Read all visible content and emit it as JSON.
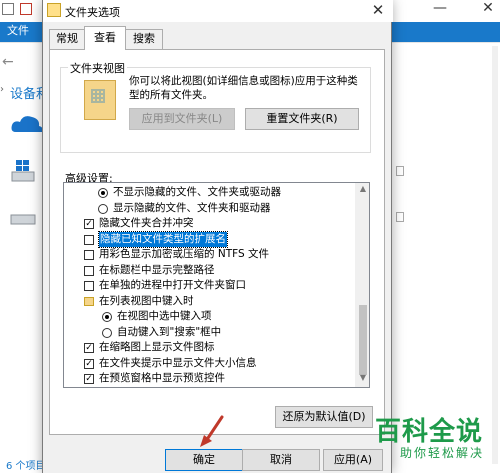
{
  "explorer": {
    "menu": "文件",
    "nav_item": "设备和",
    "status": "6 个项目",
    "minimize_icon": "minimize-icon",
    "close_icon": "close-icon"
  },
  "dialog": {
    "title": "文件夹选项",
    "tabs": [
      {
        "label": "常规"
      },
      {
        "label": "查看"
      },
      {
        "label": "搜索"
      }
    ],
    "folder_views": {
      "group_label": "文件夹视图",
      "description": "你可以将此视图(如详细信息或图标)应用于这种类型的所有文件夹。",
      "apply_button": "应用到文件夹(L)",
      "reset_button": "重置文件夹(R)"
    },
    "advanced_label": "高级设置:",
    "items": [
      {
        "kind": "radio",
        "checked": true,
        "text": "不显示隐藏的文件、文件夹或驱动器"
      },
      {
        "kind": "radio",
        "checked": false,
        "text": "显示隐藏的文件、文件夹和驱动器"
      },
      {
        "kind": "checkbox",
        "checked": true,
        "text": "隐藏文件夹合并冲突"
      },
      {
        "kind": "checkbox",
        "checked": false,
        "text": "隐藏已知文件类型的扩展名",
        "selected": true
      },
      {
        "kind": "checkbox",
        "checked": false,
        "text": "用彩色显示加密或压缩的 NTFS 文件"
      },
      {
        "kind": "checkbox",
        "checked": false,
        "text": "在标题栏中显示完整路径"
      },
      {
        "kind": "checkbox",
        "checked": false,
        "text": "在单独的进程中打开文件夹窗口"
      },
      {
        "kind": "folder",
        "text": "在列表视图中键入时"
      },
      {
        "kind": "radio",
        "checked": true,
        "text": "在视图中选中键入项"
      },
      {
        "kind": "radio",
        "checked": false,
        "text": "自动键入到\"搜索\"框中"
      },
      {
        "kind": "checkbox",
        "checked": true,
        "text": "在缩略图上显示文件图标"
      },
      {
        "kind": "checkbox",
        "checked": true,
        "text": "在文件夹提示中显示文件大小信息"
      },
      {
        "kind": "checkbox",
        "checked": true,
        "text": "在预览窗格中显示预览控件"
      }
    ],
    "restore_defaults": "还原为默认值(D)",
    "ok": "确定",
    "cancel": "取消",
    "apply": "应用(A)"
  },
  "watermark": {
    "big": "百科全说",
    "small": "助你轻松解决"
  },
  "colors": {
    "accent": "#0078d7",
    "ribbon": "#1979ca",
    "watermark": "#1e9a4a",
    "arrow": "#c0392b"
  }
}
